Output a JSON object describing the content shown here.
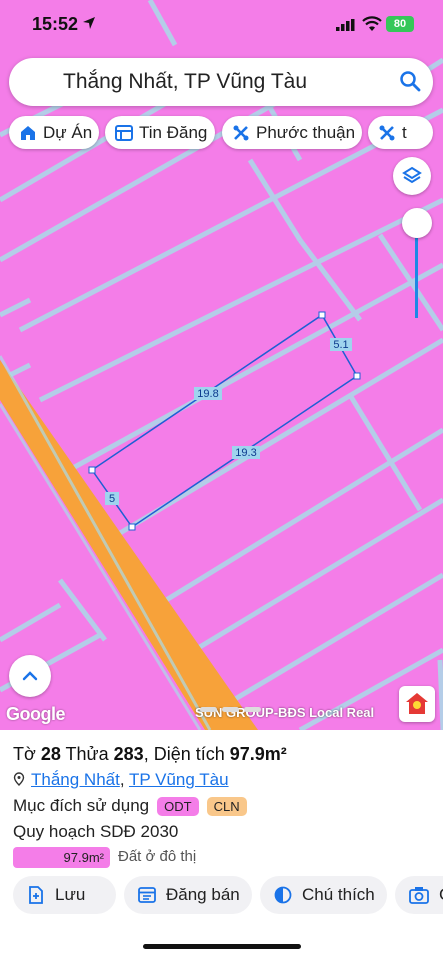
{
  "status_bar": {
    "time": "15:52",
    "battery": "80"
  },
  "search": {
    "text": "Thắng Nhất, TP Vũng Tàu"
  },
  "chips": [
    {
      "label": "Dự Án",
      "icon": "home-icon"
    },
    {
      "label": "Tin Đăng",
      "icon": "listing-icon"
    },
    {
      "label": "Phước thuận",
      "icon": "tools-icon"
    },
    {
      "label": "t",
      "icon": "tools-icon"
    }
  ],
  "map": {
    "zone_color": "#f47de8",
    "road_color": "#f7a23a",
    "edge_labels": [
      "5.1",
      "19.8",
      "19.3",
      "5"
    ]
  },
  "attribution": {
    "google": "Google",
    "source": "SUN GROUP-BĐS Local Real"
  },
  "parcel": {
    "title_prefix": "Tờ",
    "sheet_no": "28",
    "lot_label": "Thửa",
    "lot_no": "283",
    "area_label": "Diện tích",
    "area": "97.9m²",
    "ward": "Thắng Nhất",
    "city": "TP Vũng Tàu",
    "purpose_label": "Mục đích sử dụng",
    "purpose_tags": [
      {
        "code": "ODT",
        "color": "#f47de8"
      },
      {
        "code": "CLN",
        "color": "#f9c78a"
      }
    ],
    "plan_label": "Quy hoạch SDĐ 2030",
    "plan_area": "97.9m²",
    "plan_use": "Đất ở đô thị"
  },
  "actions": [
    {
      "label": "Lưu",
      "icon": "save-plus-icon"
    },
    {
      "label": "Đăng bán",
      "icon": "post-sale-icon"
    },
    {
      "label": "Chú thích",
      "icon": "legend-contrast-icon"
    },
    {
      "label": "C",
      "icon": "camera-plus-icon"
    }
  ]
}
